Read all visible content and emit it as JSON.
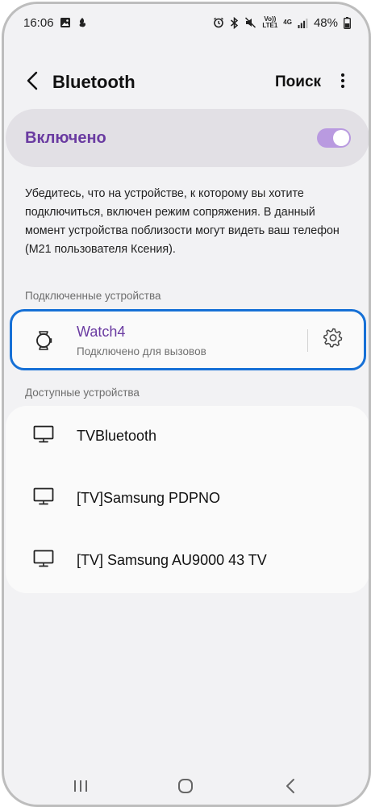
{
  "status_bar": {
    "time": "16:06",
    "network_top": "Vo))",
    "network_bottom": "LTE1",
    "data_type": "4G",
    "battery": "48%",
    "icons": [
      "gallery-icon",
      "app-notification-icon",
      "alarm-icon",
      "bluetooth-icon",
      "mute-icon",
      "signal-icon",
      "battery-icon"
    ]
  },
  "header": {
    "title": "Bluetooth",
    "search_label": "Поиск",
    "icons": [
      "back-chevron-icon",
      "more-vertical-icon"
    ]
  },
  "toggle": {
    "label": "Включено",
    "state": "on",
    "accent_color": "#6a3ba1",
    "switch_color": "#b99ae0"
  },
  "info": {
    "text": "Убедитесь, что на устройстве, к которому вы хотите подключиться, включен режим сопряжения. В данный момент устройства поблизости могут видеть ваш телефон (M21 пользователя Ксения)."
  },
  "connected": {
    "header": "Подключенные устройства",
    "device": {
      "name": "Watch4",
      "status": "Подключено для вызовов",
      "icon": "watch-icon",
      "highlight_color": "#1670d6"
    }
  },
  "available": {
    "header": "Доступные устройства",
    "devices": [
      {
        "name": "TVBluetooth",
        "icon": "tv-icon"
      },
      {
        "name": "[TV]Samsung PDPNO",
        "icon": "tv-icon"
      },
      {
        "name": "[TV] Samsung AU9000 43 TV",
        "icon": "tv-icon"
      }
    ]
  },
  "nav_bar": {
    "icons": [
      "recents-icon",
      "home-icon",
      "back-nav-icon"
    ]
  }
}
